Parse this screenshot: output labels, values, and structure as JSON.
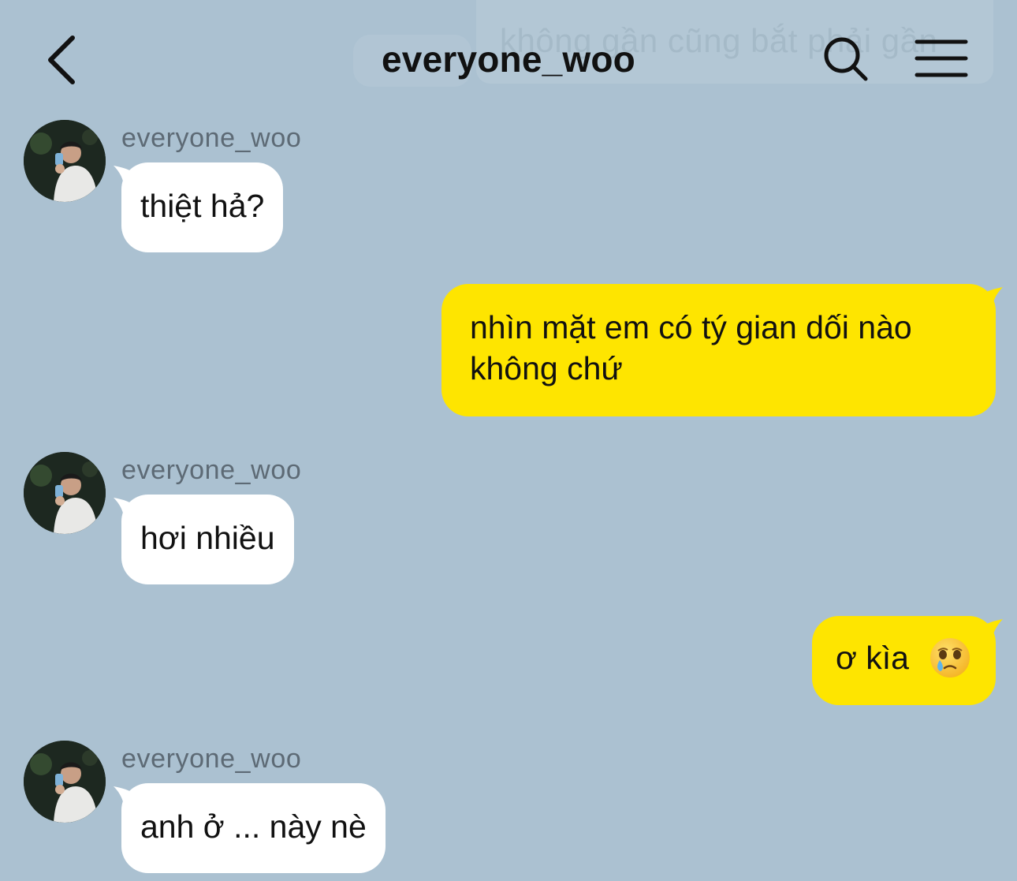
{
  "header": {
    "title": "everyone_woo",
    "ghost_text": "không gần cũng bắt phải gần"
  },
  "icons": {
    "back": "chevron-left-icon",
    "search": "search-icon",
    "menu": "hamburger-menu-icon"
  },
  "colors": {
    "background": "#abc1d1",
    "incoming_bubble": "#ffffff",
    "outgoing_bubble": "#fee500",
    "sender_name": "#5d6a75"
  },
  "messages": [
    {
      "direction": "incoming",
      "sender": "everyone_woo",
      "text": "thiệt hả?"
    },
    {
      "direction": "outgoing",
      "lines": [
        "nhìn mặt em có tý gian dối nào",
        "không chứ"
      ]
    },
    {
      "direction": "incoming",
      "sender": "everyone_woo",
      "text": "hơi nhiều"
    },
    {
      "direction": "outgoing",
      "text": "ơ kìa",
      "emoji": "face-holding-back-tears-icon"
    },
    {
      "direction": "incoming",
      "sender": "everyone_woo",
      "text": "anh ở ... này nè"
    }
  ]
}
